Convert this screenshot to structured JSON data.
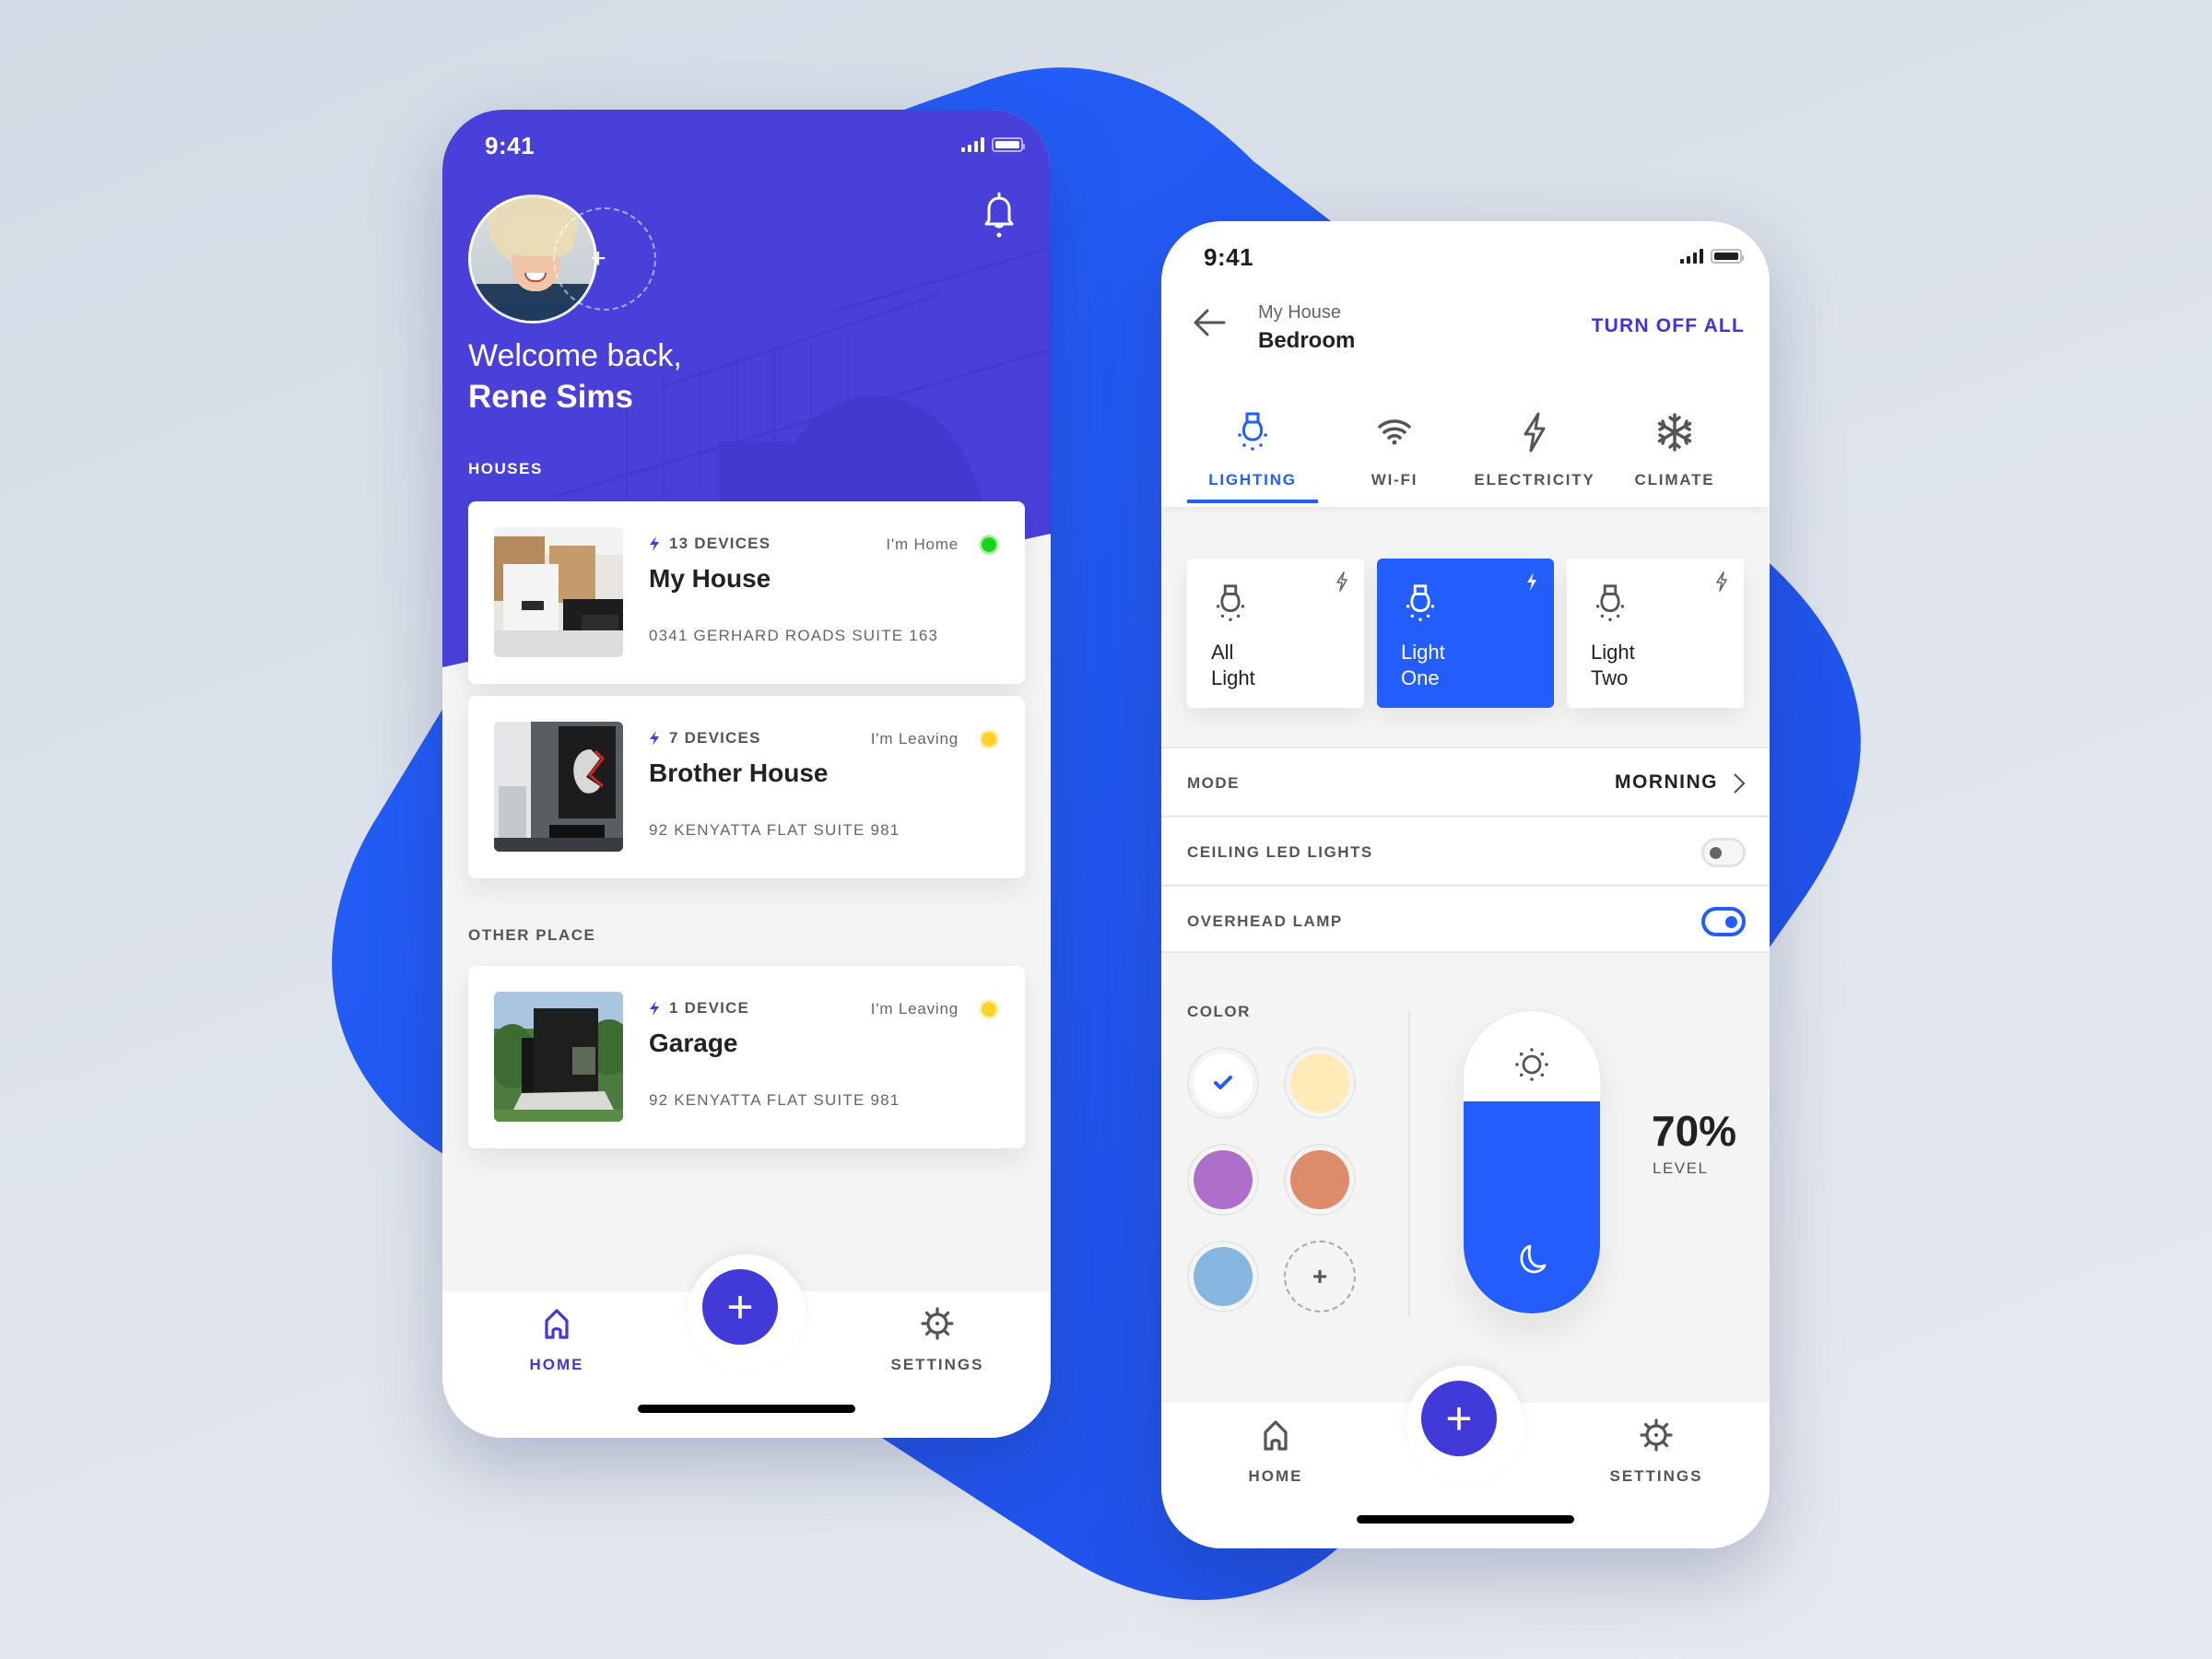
{
  "colors": {
    "primary_purple": "#4239d9",
    "hero_purple": "#4940d9",
    "accent_blue": "#235dfc",
    "blob_blue": "#2257f5",
    "status_home": "#18d418",
    "status_leaving": "#ffd22b"
  },
  "left_phone": {
    "status_bar": {
      "time": "9:41"
    },
    "header": {
      "avatar_alt": "Rene Sims avatar",
      "add_member_symbol": "+",
      "notification_icon": "bell-icon",
      "welcome_text": "Welcome back,",
      "user_name": "Rene Sims"
    },
    "sections": {
      "houses_label": "HOUSES",
      "other_label": "OTHER PLACE"
    },
    "houses": [
      {
        "devices": "13 DEVICES",
        "presence": "I'm Home",
        "presence_status": "home",
        "name": "My House",
        "address": "0341 GERHARD ROADS SUITE 163"
      },
      {
        "devices": "7 DEVICES",
        "presence": "I'm Leaving",
        "presence_status": "leaving",
        "name": "Brother House",
        "address": "92 KENYATTA FLAT SUITE 981"
      }
    ],
    "other_places": [
      {
        "devices": "1 DEVICE",
        "presence": "I'm Leaving",
        "presence_status": "leaving",
        "name": "Garage",
        "address": "92 KENYATTA FLAT SUITE 981"
      }
    ],
    "tabbar": {
      "home_label": "HOME",
      "add_symbol": "+",
      "settings_label": "SETTINGS",
      "active": "home"
    }
  },
  "right_phone": {
    "status_bar": {
      "time": "9:41"
    },
    "header": {
      "back_icon": "arrow-left-icon",
      "house": "My House",
      "room": "Bedroom",
      "turn_off_all": "TURN OFF ALL"
    },
    "categories": [
      {
        "label": "LIGHTING",
        "icon": "bulb-icon",
        "active": true
      },
      {
        "label": "WI-FI",
        "icon": "wifi-icon",
        "active": false
      },
      {
        "label": "ELECTRICITY",
        "icon": "bolt-icon",
        "active": false
      },
      {
        "label": "CLIMATE",
        "icon": "snowflake-icon",
        "active": false
      }
    ],
    "lights": [
      {
        "name": "All\nLight",
        "active": false
      },
      {
        "name": "Light\nOne",
        "active": true
      },
      {
        "name": "Light\nTwo",
        "active": false
      }
    ],
    "settings": {
      "mode_label": "MODE",
      "mode_value": "MORNING",
      "ceiling_label": "CEILING LED LIGHTS",
      "ceiling_on": false,
      "overhead_label": "OVERHEAD LAMP",
      "overhead_on": true
    },
    "color": {
      "label": "COLOR",
      "swatches": [
        "#ffffff",
        "#ffeab8",
        "#ae6fca",
        "#dc8c6a",
        "#86b5df"
      ],
      "selected_index": 0,
      "add_symbol": "+"
    },
    "level": {
      "percent": 70,
      "value_text": "70%",
      "label": "LEVEL"
    },
    "tabbar": {
      "home_label": "HOME",
      "add_symbol": "+",
      "settings_label": "SETTINGS",
      "active": "none"
    }
  }
}
